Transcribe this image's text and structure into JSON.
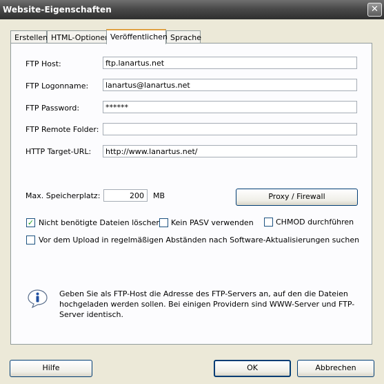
{
  "window": {
    "title": "Website-Eigenschaften",
    "close_glyph": "✕"
  },
  "tabs": [
    {
      "label": "Erstellen",
      "active": false
    },
    {
      "label": "HTML-Optionen",
      "active": false
    },
    {
      "label": "Veröffentlichen",
      "active": true
    },
    {
      "label": "Sprache",
      "active": false
    }
  ],
  "form": {
    "ftp_host": {
      "label": "FTP Host:",
      "value": "ftp.lanartus.net"
    },
    "ftp_login": {
      "label": "FTP Logonname:",
      "value": "lanartus@lanartus.net"
    },
    "ftp_password": {
      "label": "FTP Password:",
      "value": "******"
    },
    "ftp_remote_folder": {
      "label": "FTP Remote Folder:",
      "value": ""
    },
    "http_target_url": {
      "label": "HTTP Target-URL:",
      "value": "http://www.lanartus.net/"
    },
    "max_storage": {
      "label": "Max. Speicherplatz:",
      "value": "200",
      "unit": "MB"
    },
    "proxy_button": "Proxy / Firewall"
  },
  "options": [
    {
      "label": "Nicht benötigte Dateien löschen",
      "checked": true
    },
    {
      "label": "Kein PASV verwenden",
      "checked": false
    },
    {
      "label": "CHMOD durchführen",
      "checked": false
    },
    {
      "label": "Vor dem Upload in regelmäßigen Abständen nach Software-Aktualisierungen suchen",
      "checked": false
    }
  ],
  "info": {
    "icon": "info-icon",
    "text": "Geben Sie als FTP-Host die Adresse des FTP-Servers an, auf den die Dateien hochgeladen werden sollen. Bei einigen Providern sind WWW-Server und FTP-Server identisch."
  },
  "buttons": {
    "help": "Hilfe",
    "ok": "OK",
    "cancel": "Abbrechen"
  },
  "colors": {
    "titlebar": "#4a4a4a",
    "dialog_bg": "#ece9d8",
    "panel_bg": "#fcfcfe",
    "check_mark": "#21a121",
    "active_tab_accent": "#e0a040"
  }
}
